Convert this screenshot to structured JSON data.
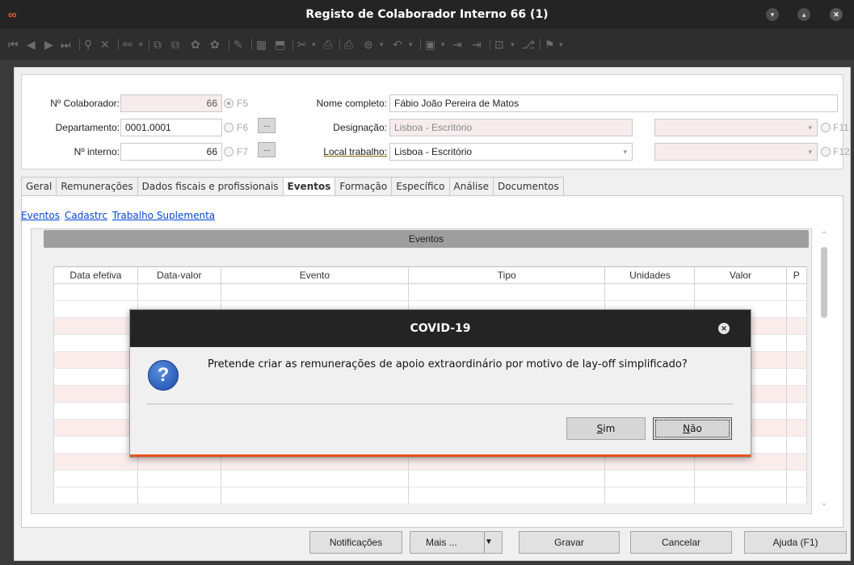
{
  "window": {
    "title": "Registo de Colaborador Interno 66 (1)",
    "logo": "∞"
  },
  "toolbar": {
    "icons": [
      "first-record-icon",
      "prev-record-icon",
      "next-record-icon",
      "last-record-icon",
      "search-icon",
      "clear-filter-icon",
      "find-icon",
      "find-dropdown-icon",
      "copy-icon",
      "paste-icon",
      "attach-icon",
      "detach-icon",
      "edit-icon",
      "calendar-grid-icon",
      "export-icon",
      "tools-icon",
      "print-icon",
      "preview-icon",
      "undo-icon",
      "save-icon",
      "nav-icon",
      "lock-icon",
      "flag-icon"
    ]
  },
  "header": {
    "colab_label": "Nº Colaborador:",
    "colab_value": "66",
    "f5": "F5",
    "nome_label": "Nome completo:",
    "nome_value": "Fábio João Pereira de Matos",
    "dept_label": "Departamento:",
    "dept_value": "0001.0001",
    "f6": "F6",
    "dots": "...",
    "designacao_label": "Designação:",
    "designacao_value": "Lisboa - Escritório",
    "f11": "F11",
    "interno_label": "Nº interno:",
    "interno_value": "66",
    "f7": "F7",
    "local_label": "Local trabalho:",
    "local_value": "Lisboa - Escritório",
    "f12": "F12"
  },
  "tabs": [
    {
      "label": "Geral"
    },
    {
      "label": "Remunerações"
    },
    {
      "label": "Dados fiscais e profissionais"
    },
    {
      "label": "Eventos"
    },
    {
      "label": "Formação"
    },
    {
      "label": "Específico"
    },
    {
      "label": "Análise"
    },
    {
      "label": "Documentos"
    }
  ],
  "sublinks": [
    "Eventos",
    "Cadastrc",
    "Trabalho Suplementa"
  ],
  "events": {
    "bar_title": "Eventos",
    "columns": [
      "Data efetiva",
      "Data-valor",
      "Evento",
      "Tipo",
      "Unidades",
      "Valor",
      "P"
    ]
  },
  "buttons": {
    "notificacoes": "Notificações",
    "mais": "Mais ...",
    "gravar": "Gravar",
    "cancelar": "Cancelar",
    "ajuda": "Ajuda (F1)"
  },
  "modal": {
    "title": "COVID-19",
    "message": "Pretende criar as remunerações de apoio extraordinário por motivo de lay-off simplificado?",
    "icon_glyph": "?",
    "yes_accel": "S",
    "yes_rest": "im",
    "no_accel": "N",
    "no_rest": "ão"
  },
  "colors": {
    "accent": "#e8541c",
    "titlebar": "#242424",
    "link": "#0645d6",
    "row_alt": "#fbecec"
  }
}
